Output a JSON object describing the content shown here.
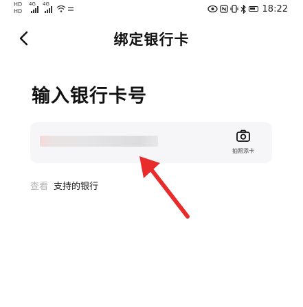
{
  "status_bar": {
    "left_badges": [
      "HD",
      "HD"
    ],
    "left_network": [
      "4G",
      "4G"
    ],
    "time": "18:22"
  },
  "nav": {
    "back_icon": "chevron-left-icon",
    "title": "绑定银行卡"
  },
  "form": {
    "section_title": "输入银行卡号",
    "card_number_value": "",
    "scan_label": "拍照添卡",
    "scan_icon": "camera-icon"
  },
  "support": {
    "prefix": "查看",
    "link": "支持的银行"
  },
  "colors": {
    "annotation_arrow": "#e82b2b",
    "card_background": "#f6f6f8",
    "muted_text": "#b5b5b5"
  }
}
